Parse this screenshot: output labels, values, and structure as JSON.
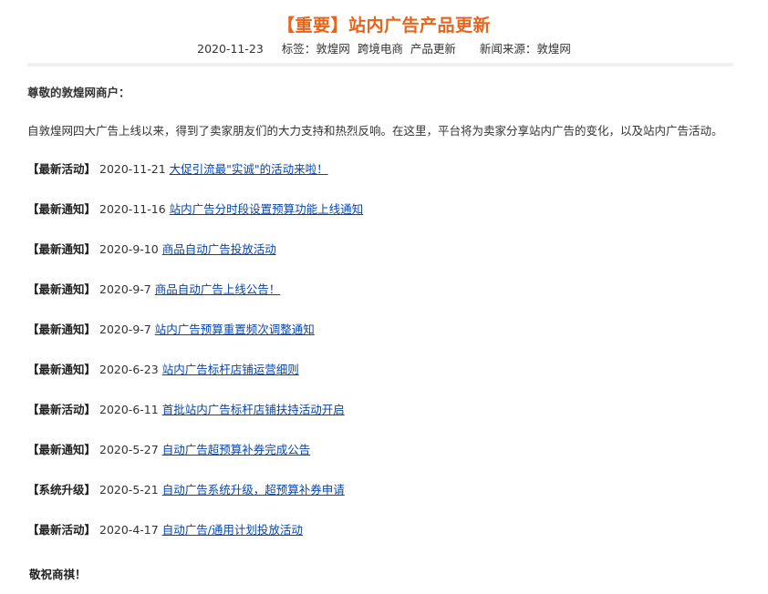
{
  "article": {
    "title": "【重要】站内广告产品更新",
    "date": "2020-11-23",
    "tags_label": "标签：",
    "tags": [
      "敦煌网",
      "跨境电商",
      "产品更新"
    ],
    "source_label": "新闻来源：",
    "source": "敦煌网"
  },
  "body": {
    "greeting": "尊敬的敦煌网商户：",
    "intro": "自敦煌网四大广告上线以来，得到了卖家朋友们的大力支持和热烈反响。在这里，平台将为卖家分享站内广告的变化，以及站内广告活动。",
    "items": [
      {
        "tag": "【最新活动】",
        "date": "2020-11-21",
        "link": "大促引流最\"实诚\"的活动来啦！"
      },
      {
        "tag": "【最新通知】",
        "date": "2020-11-16",
        "link": "站内广告分时段设置预算功能上线通知"
      },
      {
        "tag": "【最新通知】",
        "date": "2020-9-10",
        "link": "商品自动广告投放活动"
      },
      {
        "tag": "【最新通知】",
        "date": "2020-9-7",
        "link": "商品自动广告上线公告！"
      },
      {
        "tag": "【最新通知】",
        "date": "2020-9-7",
        "link": "站内广告预算重置频次调整通知"
      },
      {
        "tag": "【最新通知】",
        "date": "2020-6-23",
        "link": "站内广告标杆店铺运营细则"
      },
      {
        "tag": "【最新活动】",
        "date": "2020-6-11",
        "link": "首批站内广告标杆店铺扶持活动开启"
      },
      {
        "tag": "【最新通知】",
        "date": "2020-5-27",
        "link": "自动广告超预算补券完成公告"
      },
      {
        "tag": "【系统升级】",
        "date": "2020-5-21",
        "link": "自动广告系统升级，超预算补券申请"
      },
      {
        "tag": "【最新活动】",
        "date": "2020-4-17",
        "link": "自动广告/通用计划投放活动"
      }
    ],
    "closing": "敬祝商祺！"
  },
  "colors": {
    "title": "#e8641b",
    "link": "#0645ad",
    "text": "#333333"
  }
}
